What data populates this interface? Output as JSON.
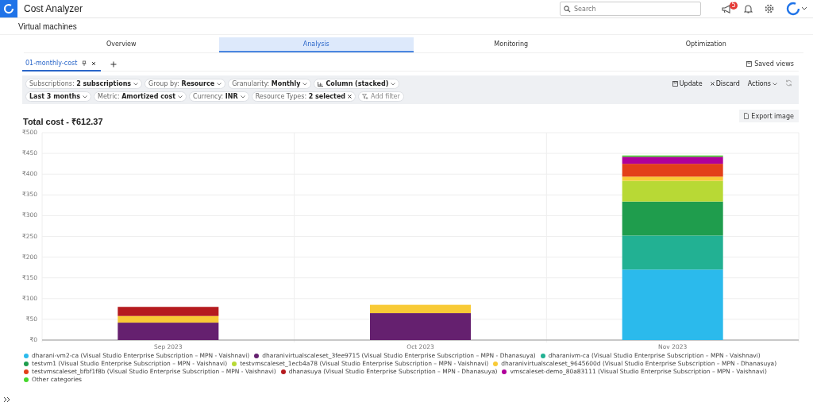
{
  "app": {
    "title": "Cost Analyzer",
    "search": {
      "placeholder": "Search"
    },
    "notification_badge": "5"
  },
  "page": {
    "title": "Virtual machines"
  },
  "tabs": [
    {
      "label": "Overview",
      "selected": false
    },
    {
      "label": "Analysis",
      "selected": true
    },
    {
      "label": "Monitoring",
      "selected": false
    },
    {
      "label": "Optimization",
      "selected": false
    }
  ],
  "views": [
    {
      "label": "01-monthly-cost",
      "selected": true
    }
  ],
  "saved_views": "Saved views",
  "filters": [
    [
      {
        "text": "Subscriptions: **2 subscriptions**",
        "kind": "dropdown"
      },
      {
        "text": "Group by: **Resource**",
        "kind": "dropdown"
      },
      {
        "text": "Granularity: **Monthly**",
        "kind": "dropdown"
      },
      {
        "text": "Column (stacked)",
        "kind": "view"
      }
    ],
    [
      {
        "text": "**Last 3 months**",
        "kind": "dropdown"
      },
      {
        "text": "Metric: **Amortized cost**",
        "kind": "dropdown"
      },
      {
        "text": "Currency: **INR**",
        "kind": "dropdown"
      },
      {
        "text": "Resource Types: **2 selected**",
        "kind": "removable"
      },
      {
        "text": "Add filter",
        "kind": "add"
      }
    ]
  ],
  "actions": [
    {
      "label": "Update",
      "kind": "save"
    },
    {
      "label": "Discard",
      "kind": "discard"
    },
    {
      "label": "Actions",
      "kind": "menu"
    }
  ],
  "export": "Export image",
  "chart_data": {
    "type": "bar",
    "stacked": true,
    "grid": true,
    "title": "Total cost - ₹612.37",
    "categories": [
      "Sep 2023",
      "Oct 2023",
      "Nov 2023"
    ],
    "ylim": [
      0,
      500
    ],
    "yticks": [
      {
        "value": 0,
        "label": "₹0"
      },
      {
        "value": 50,
        "label": "₹50"
      },
      {
        "value": 100,
        "label": "₹100"
      },
      {
        "value": 150,
        "label": "₹150"
      },
      {
        "value": 200,
        "label": "₹200"
      },
      {
        "value": 250,
        "label": "₹250"
      },
      {
        "value": 300,
        "label": "₹300"
      },
      {
        "value": 350,
        "label": "₹350"
      },
      {
        "value": 400,
        "label": "₹400"
      },
      {
        "value": 450,
        "label": "₹450"
      },
      {
        "value": 500,
        "label": "₹500"
      }
    ],
    "series": [
      {
        "name": "dharani-vm2-ca (Visual Studio Enterprise Subscription – MPN - Vaishnavi)",
        "color": "#2bbaec",
        "values": [
          null,
          null,
          170
        ]
      },
      {
        "name": "dharanivirtualscaleset_3fee9715 (Visual Studio Enterprise Subscription – MPN - Dhanasuya)",
        "color": "#65206f",
        "values": [
          42,
          65,
          null
        ]
      },
      {
        "name": "dharanivm-ca (Visual Studio Enterprise Subscription – MPN - Vaishnavi)",
        "color": "#22b193",
        "values": [
          null,
          null,
          82
        ]
      },
      {
        "name": "testvm1 (Visual Studio Enterprise Subscription – MPN - Vaishnavi)",
        "color": "#1f9d4d",
        "values": [
          null,
          null,
          82
        ]
      },
      {
        "name": "testvmscaleset_1ecb4a78 (Visual Studio Enterprise Subscription – MPN - Vaishnavi)",
        "color": "#b8d935",
        "values": [
          null,
          null,
          50
        ]
      },
      {
        "name": "dharanivirtualscaleset_9645600d (Visual Studio Enterprise Subscription – MPN - Dhanasuya)",
        "color": "#f8ca36",
        "values": [
          16,
          20,
          10
        ]
      },
      {
        "name": "testvmscaleset_bfbf1f8b (Visual Studio Enterprise Subscription – MPN - Vaishnavi)",
        "color": "#e33f19",
        "values": [
          null,
          null,
          31
        ]
      },
      {
        "name": "dhanasuya (Visual Studio Enterprise Subscription – MPN - Dhanasuya)",
        "color": "#b51b1f",
        "values": [
          22,
          null,
          null
        ]
      },
      {
        "name": "vmscaleset-demo_80a83111 (Visual Studio Enterprise Subscription – MPN - Vaishnavi)",
        "color": "#b0009a",
        "values": [
          null,
          null,
          17
        ]
      },
      {
        "name": "Other categories",
        "color": "#45d82c",
        "values": [
          null,
          null,
          3
        ]
      }
    ]
  }
}
